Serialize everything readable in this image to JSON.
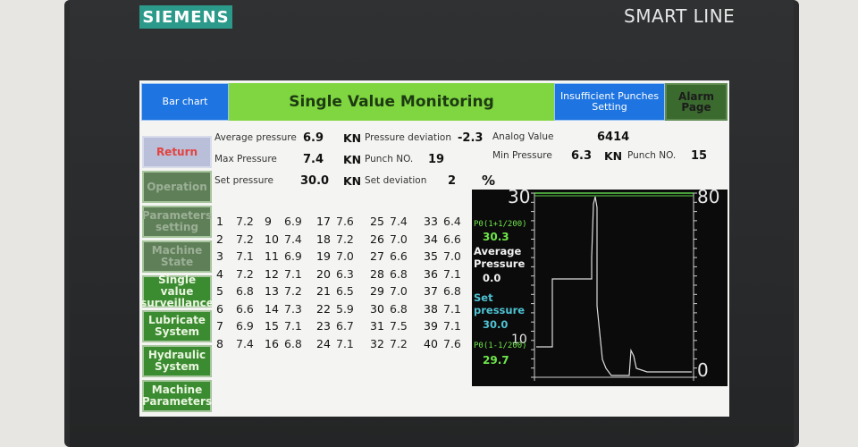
{
  "device": {
    "brand": "SIEMENS",
    "product_line": "SMART LINE"
  },
  "header": {
    "bar_chart_button": "Bar chart",
    "title": "Single Value Monitoring",
    "insufficient_punches_button": "Insufficient Punches Setting",
    "alarm_page_button": "Alarm Page"
  },
  "sidebar": {
    "items": [
      {
        "label": "Return"
      },
      {
        "label": "Operation"
      },
      {
        "label": "Parameters setting"
      },
      {
        "label": "Machine State"
      },
      {
        "label": "Single value surveillance"
      },
      {
        "label": "Lubricate System"
      },
      {
        "label": "Hydraulic System"
      },
      {
        "label": "Machine Parameters"
      }
    ]
  },
  "stats": {
    "average_pressure": {
      "label": "Average pressure",
      "value": "6.9",
      "unit": "KN"
    },
    "pressure_deviation": {
      "label": "Pressure deviation",
      "value": "-2.3"
    },
    "analog_value": {
      "label": "Analog Value",
      "value": "6414"
    },
    "max_pressure": {
      "label": "Max Pressure",
      "value": "7.4",
      "unit": "KN"
    },
    "punch_no_1": {
      "label": "Punch NO.",
      "value": "19"
    },
    "min_pressure": {
      "label": "Min Pressure",
      "value": "6.3",
      "unit": "KN"
    },
    "punch_no_2": {
      "label": "Punch NO.",
      "value": "15"
    },
    "set_pressure": {
      "label": "Set pressure",
      "value": "30.0",
      "unit": "KN"
    },
    "set_deviation": {
      "label": "Set deviation",
      "value": "2",
      "unit": "%"
    }
  },
  "punch_grid": [
    [
      [
        "1",
        "7.2"
      ],
      [
        "9",
        "6.9"
      ],
      [
        "17",
        "7.6"
      ],
      [
        "25",
        "7.4"
      ],
      [
        "33",
        "6.4"
      ]
    ],
    [
      [
        "2",
        "7.2"
      ],
      [
        "10",
        "7.4"
      ],
      [
        "18",
        "7.2"
      ],
      [
        "26",
        "7.0"
      ],
      [
        "34",
        "6.6"
      ]
    ],
    [
      [
        "3",
        "7.1"
      ],
      [
        "11",
        "6.9"
      ],
      [
        "19",
        "7.0"
      ],
      [
        "27",
        "6.6"
      ],
      [
        "35",
        "7.0"
      ]
    ],
    [
      [
        "4",
        "7.2"
      ],
      [
        "12",
        "7.1"
      ],
      [
        "20",
        "6.3"
      ],
      [
        "28",
        "6.8"
      ],
      [
        "36",
        "7.1"
      ]
    ],
    [
      [
        "5",
        "6.8"
      ],
      [
        "13",
        "7.2"
      ],
      [
        "21",
        "6.5"
      ],
      [
        "29",
        "7.0"
      ],
      [
        "37",
        "6.8"
      ]
    ],
    [
      [
        "6",
        "6.6"
      ],
      [
        "14",
        "7.3"
      ],
      [
        "22",
        "5.9"
      ],
      [
        "30",
        "6.8"
      ],
      [
        "38",
        "7.1"
      ]
    ],
    [
      [
        "7",
        "6.9"
      ],
      [
        "15",
        "7.1"
      ],
      [
        "23",
        "6.7"
      ],
      [
        "31",
        "7.5"
      ],
      [
        "39",
        "7.1"
      ]
    ],
    [
      [
        "8",
        "7.4"
      ],
      [
        "16",
        "6.8"
      ],
      [
        "24",
        "7.1"
      ],
      [
        "32",
        "7.2"
      ],
      [
        "40",
        "7.6"
      ]
    ]
  ],
  "chart_panel": {
    "p0_upper_label": "P0(1+1/200)",
    "p0_upper_value": "30.3",
    "average_label": "Average Pressure",
    "average_value": "0.0",
    "set_label": "Set pressure",
    "set_value": "30.0",
    "p0_lower_label": "P0(1-1/200)",
    "p0_lower_value": "29.7",
    "left_axis_top": "30",
    "left_axis_mid": "10",
    "right_axis_top": "80",
    "right_axis_bottom": "0"
  },
  "colors": {
    "title_bg": "#7fd640",
    "blue_button": "#1e74e0",
    "nav_green": "#3b8b30",
    "trace": "#d8d8d8"
  }
}
